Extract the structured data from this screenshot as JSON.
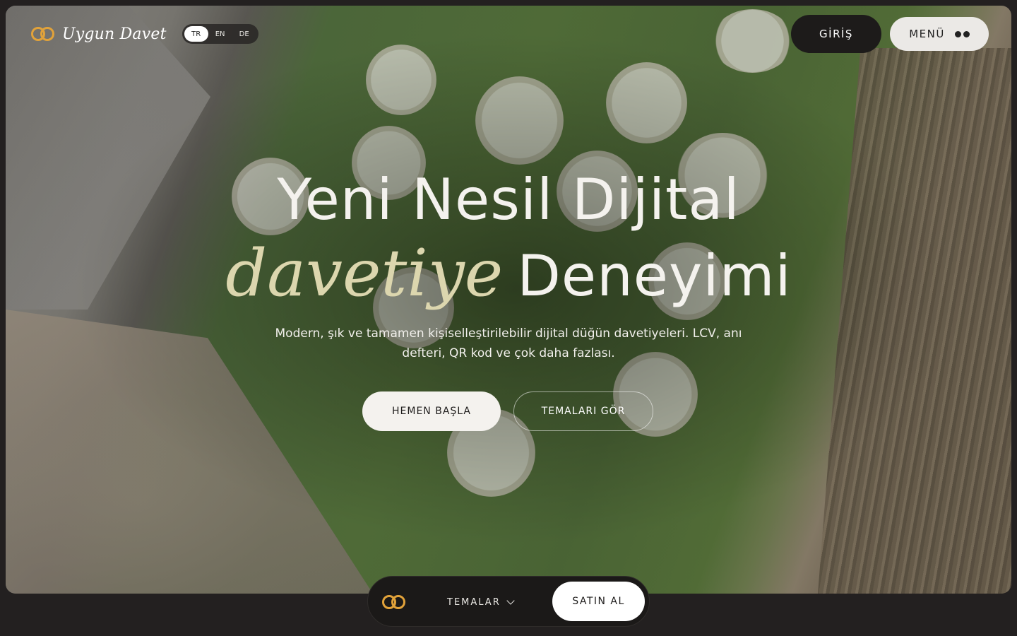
{
  "brand": {
    "name": "Uygun Davet",
    "icon": "rings-icon",
    "accent": "#e1a23a"
  },
  "languages": [
    {
      "code": "TR",
      "active": true
    },
    {
      "code": "EN",
      "active": false
    },
    {
      "code": "DE",
      "active": false
    }
  ],
  "header": {
    "login_label": "GİRİŞ",
    "menu_label": "MENÜ",
    "menu_icon": "dots-icon"
  },
  "hero": {
    "title_line1": "Yeni Nesil Dijital",
    "title_script": "davetiye",
    "title_word": "Deneyimi",
    "subtitle": "Modern, şık ve tamamen kişiselleştirilebilir dijital düğün davetiyeleri. LCV, anı defteri, QR kod ve çok daha fazlası.",
    "primary_cta": "HEMEN BAŞLA",
    "secondary_cta": "TEMALARI GÖR",
    "script_color": "#dcd6ae"
  },
  "dock": {
    "themes_label": "TEMALAR",
    "buy_label": "SATIN AL"
  }
}
